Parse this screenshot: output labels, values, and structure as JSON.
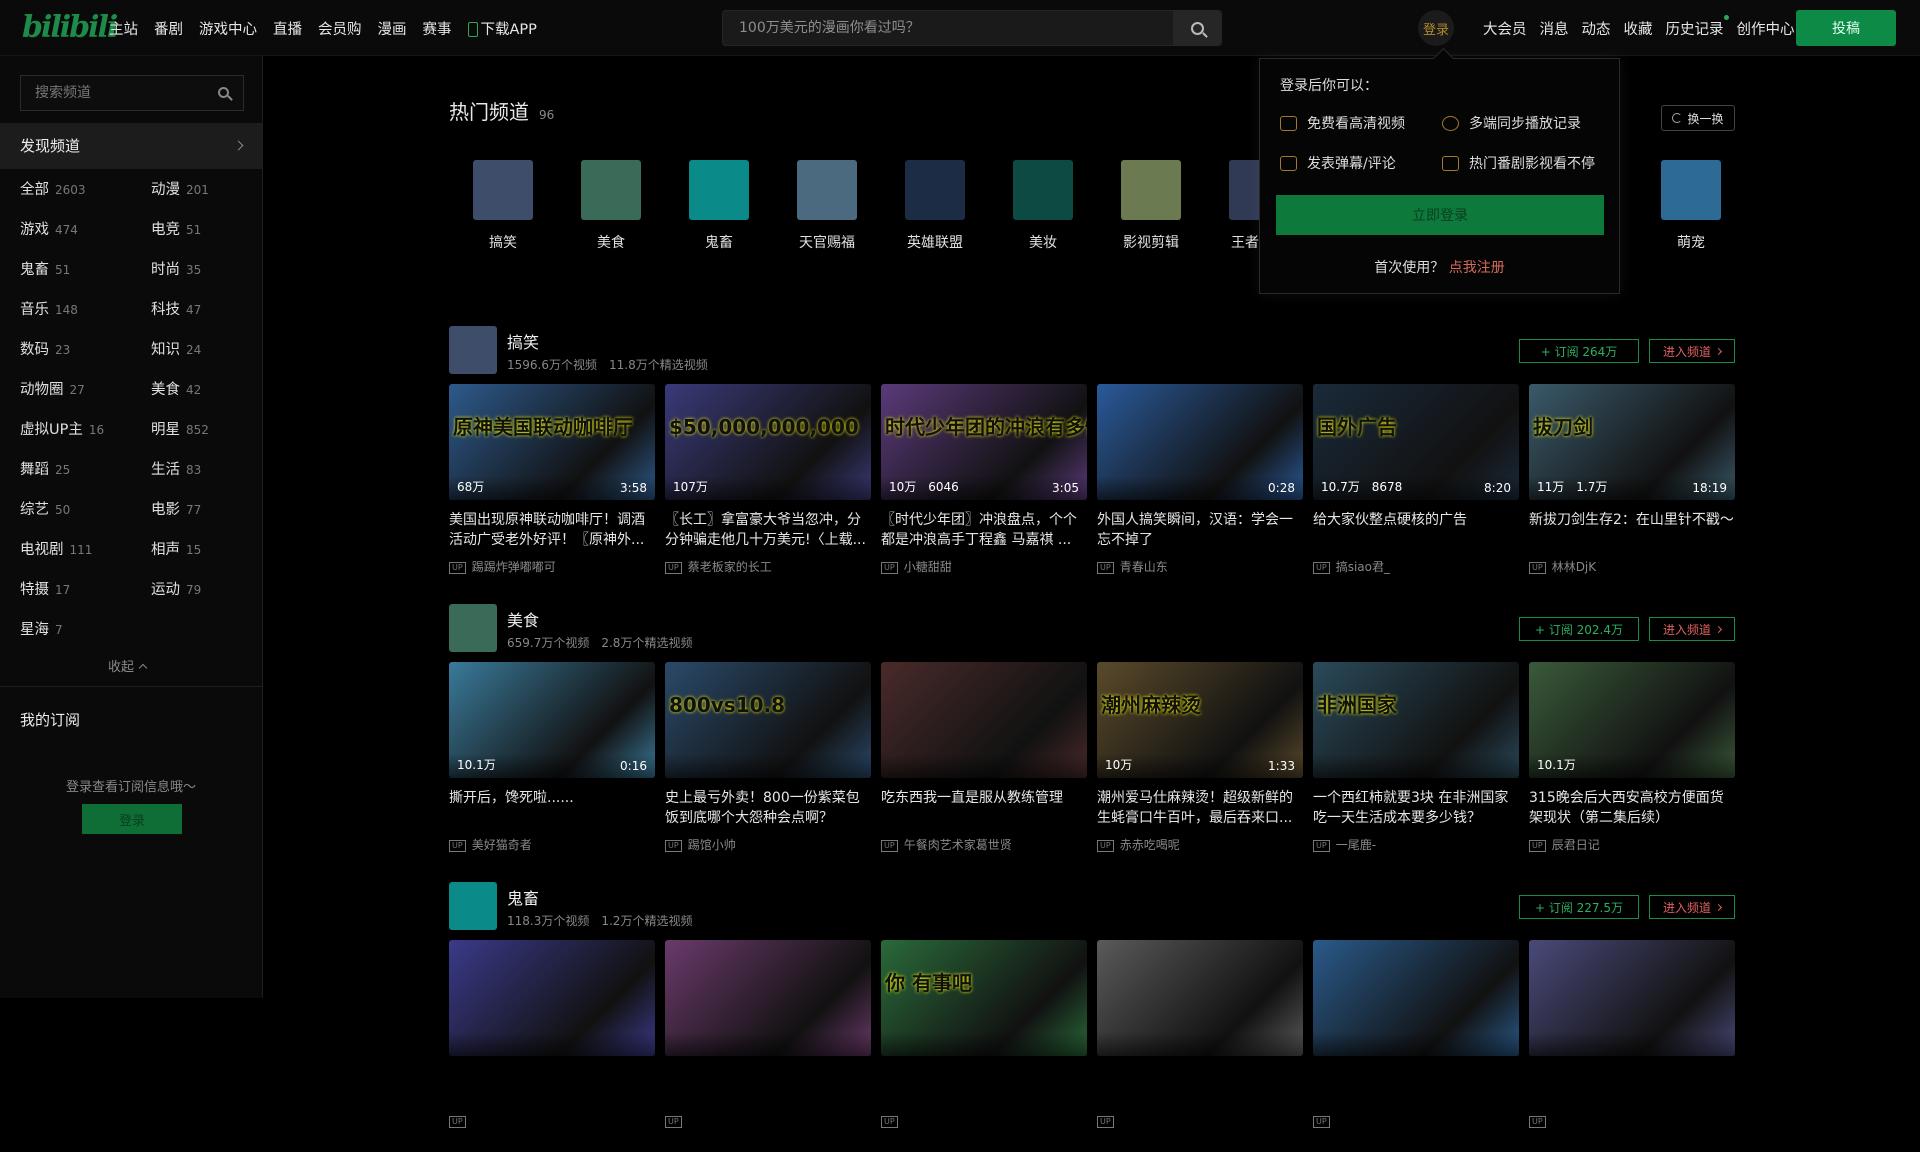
{
  "header": {
    "logo": "bilibili",
    "nav": [
      "主站",
      "番剧",
      "游戏中心",
      "直播",
      "会员购",
      "漫画",
      "赛事",
      "下载APP"
    ],
    "search_placeholder": "100万美元的漫画你看过吗？",
    "login_avatar": "登录",
    "right_nav": [
      "大会员",
      "消息",
      "动态",
      "收藏",
      "历史记录",
      "创作中心"
    ],
    "post_button": "投稿"
  },
  "sidebar": {
    "search_placeholder": "搜索频道",
    "discover": "发现频道",
    "categories": [
      {
        "name": "全部",
        "count": "2603"
      },
      {
        "name": "动漫",
        "count": "201"
      },
      {
        "name": "游戏",
        "count": "474"
      },
      {
        "name": "电竞",
        "count": "51"
      },
      {
        "name": "鬼畜",
        "count": "51"
      },
      {
        "name": "时尚",
        "count": "35"
      },
      {
        "name": "音乐",
        "count": "148"
      },
      {
        "name": "科技",
        "count": "47"
      },
      {
        "name": "数码",
        "count": "23"
      },
      {
        "name": "知识",
        "count": "24"
      },
      {
        "name": "动物圈",
        "count": "27"
      },
      {
        "name": "美食",
        "count": "42"
      },
      {
        "name": "虚拟UP主",
        "count": "16"
      },
      {
        "name": "明星",
        "count": "852"
      },
      {
        "name": "舞蹈",
        "count": "25"
      },
      {
        "name": "生活",
        "count": "83"
      },
      {
        "name": "综艺",
        "count": "50"
      },
      {
        "name": "电影",
        "count": "77"
      },
      {
        "name": "电视剧",
        "count": "111"
      },
      {
        "name": "相声",
        "count": "15"
      },
      {
        "name": "特摄",
        "count": "17"
      },
      {
        "name": "运动",
        "count": "79"
      },
      {
        "name": "星海",
        "count": "7"
      }
    ],
    "collapse": "收起",
    "my_subscriptions": "我的订阅",
    "sub_hint": "登录查看订阅信息哦～",
    "login": "登录"
  },
  "hot": {
    "title": "热门频道",
    "count": "96",
    "swap": "换一换",
    "channels": [
      {
        "name": "搞笑",
        "color": "#3d4d6a"
      },
      {
        "name": "美食",
        "color": "#3a6b58"
      },
      {
        "name": "鬼畜",
        "color": "#0b8a8a"
      },
      {
        "name": "天官赐福",
        "color": "#4b6a80"
      },
      {
        "name": "英雄联盟",
        "color": "#1b2c44"
      },
      {
        "name": "美妆",
        "color": "#0d4a44"
      },
      {
        "name": "影视剪辑",
        "color": "#6c7a52"
      },
      {
        "name": "王者荣耀",
        "color": "#303a55"
      },
      {
        "name": "",
        "color": "#000"
      },
      {
        "name": "",
        "color": "#000"
      },
      {
        "name": "",
        "color": "#000"
      },
      {
        "name": "萌宠",
        "color": "#2e6a96"
      }
    ]
  },
  "popup": {
    "title": "登录后你可以：",
    "items": [
      "免费看高清视频",
      "多端同步播放记录",
      "发表弹幕/评论",
      "热门番剧影视看不停"
    ],
    "login_button": "立即登录",
    "first_use": "首次使用？",
    "register": "点我注册"
  },
  "sections": [
    {
      "name": "搞笑",
      "stats": "1596.6万个视频　11.8万个精选视频",
      "subscribe": "+ 订阅 264万",
      "enter": "进入频道",
      "avatar_color": "#3d4d6a",
      "cards": [
        {
          "title": "美国出现原神联动咖啡厅！调酒活动广受老外好评！〖原神外...",
          "up": "踢踢炸弹嘟嘟可",
          "stats": "68万",
          "duration": "3:58",
          "caption": "原神美国联动咖啡厅",
          "color": "#2d5a8c"
        },
        {
          "title": "〖长工〗拿富豪大爷当忽冲，分分钟骗走他几十万美元!〈上载...",
          "up": "蔡老板家的长工",
          "stats": "107万",
          "duration": "",
          "caption": "$50,000,000,000",
          "color": "#3a3a7a"
        },
        {
          "title": "〖时代少年团〗冲浪盘点，个个都是冲浪高手丁程鑫 马嘉祺 ...",
          "up": "小糖甜甜",
          "stats": "10万　6046",
          "duration": "3:05",
          "caption": "时代少年团的冲浪有多怪",
          "color": "#5a3a7a"
        },
        {
          "title": "外国人搞笑瞬间，汉语：学会一忘不掉了",
          "up": "青春山东",
          "stats": "",
          "duration": "0:28",
          "caption": "",
          "color": "#2a5a9a"
        },
        {
          "title": "给大家伙整点硬核的广告",
          "up": "搞siao君_",
          "stats": "10.7万　8678",
          "duration": "8:20",
          "caption": "国外广告",
          "color": "#1a2a3a"
        },
        {
          "title": "新拔刀剑生存2：在山里针不戳～",
          "up": "林林DjK",
          "stats": "11万　1.7万",
          "duration": "18:19",
          "caption": "拔刀剑",
          "color": "#3a5a6a"
        }
      ]
    },
    {
      "name": "美食",
      "stats": "659.7万个视频　2.8万个精选视频",
      "subscribe": "+ 订阅 202.4万",
      "enter": "进入频道",
      "avatar_color": "#3a6b58",
      "cards": [
        {
          "title": "撕开后，馋死啦......",
          "up": "美好猫奇者",
          "stats": "10.1万",
          "duration": "0:16",
          "caption": "",
          "color": "#3a7a9a"
        },
        {
          "title": "史上最亏外卖！800一份紫菜包饭到底哪个大怨种会点啊？",
          "up": "踢馆小帅",
          "stats": "",
          "duration": "",
          "caption": "800vs10.8",
          "color": "#2a4a6a"
        },
        {
          "title": "吃东西我一直是服从教练管理",
          "up": "午餐肉艺术家葛世贤",
          "stats": "",
          "duration": "",
          "caption": "",
          "color": "#4a2a2a"
        },
        {
          "title": "潮州爱马仕麻辣烫！超级新鲜的生蚝膏口牛百叶，最后吞来口...",
          "up": "赤赤吃喝呢",
          "stats": "10万",
          "duration": "1:33",
          "caption": "潮州麻辣烫",
          "color": "#5a4a2a"
        },
        {
          "title": "一个西红柿就要3块 在非洲国家吃一天生活成本要多少钱？",
          "up": "一尾鹿-",
          "stats": "",
          "duration": "",
          "caption": "非洲国家",
          "color": "#2a4a5a"
        },
        {
          "title": "315晚会后大西安高校方便面货架现状（第二集后续）",
          "up": "辰君日记",
          "stats": "10.1万",
          "duration": "",
          "caption": "",
          "color": "#3a5a3a"
        }
      ]
    },
    {
      "name": "鬼畜",
      "stats": "118.3万个视频　1.2万个精选视频",
      "subscribe": "+ 订阅 227.5万",
      "enter": "进入频道",
      "avatar_color": "#0b8a8a",
      "cards": [
        {
          "title": "",
          "up": "",
          "stats": "",
          "duration": "",
          "caption": "",
          "color": "#3a3a8a"
        },
        {
          "title": "",
          "up": "",
          "stats": "",
          "duration": "",
          "caption": "",
          "color": "#6a3a6a"
        },
        {
          "title": "",
          "up": "",
          "stats": "",
          "duration": "",
          "caption": "你 有事吧",
          "color": "#2a6a3a"
        },
        {
          "title": "",
          "up": "",
          "stats": "",
          "duration": "",
          "caption": "",
          "color": "#5a5a5a"
        },
        {
          "title": "",
          "up": "",
          "stats": "",
          "duration": "",
          "caption": "",
          "color": "#2a5a8a"
        },
        {
          "title": "",
          "up": "",
          "stats": "",
          "duration": "",
          "caption": "",
          "color": "#4a4a7a"
        }
      ]
    }
  ]
}
